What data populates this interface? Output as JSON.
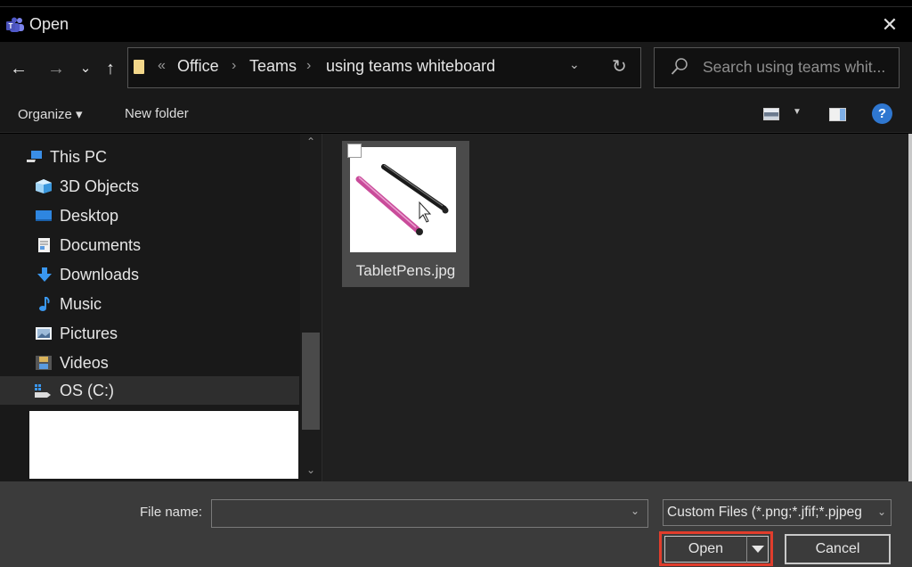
{
  "window": {
    "title": "Open",
    "app_icon": "teams-icon",
    "close_glyph": "✕"
  },
  "nav": {
    "back_glyph": "←",
    "forward_glyph": "→",
    "recent_glyph": "⌄",
    "up_glyph": "↑",
    "breadcrumb": {
      "overflow": "«",
      "items": [
        "Office",
        "Teams",
        "using teams whiteboard"
      ],
      "separator": "›"
    },
    "address_dropdown_glyph": "⌄",
    "refresh_glyph": "↻",
    "search_placeholder": "Search using teams whit..."
  },
  "toolbar": {
    "organize_label": "Organize ▾",
    "new_folder_label": "New folder",
    "view_dropdown_glyph": "▼",
    "help_glyph": "?"
  },
  "sidebar": {
    "items": [
      {
        "label": "This PC",
        "icon": "pc-icon",
        "level": 0,
        "selected": false
      },
      {
        "label": "3D Objects",
        "icon": "3d-objects-icon",
        "level": 1,
        "selected": false
      },
      {
        "label": "Desktop",
        "icon": "desktop-icon",
        "level": 1,
        "selected": false
      },
      {
        "label": "Documents",
        "icon": "documents-icon",
        "level": 1,
        "selected": false
      },
      {
        "label": "Downloads",
        "icon": "downloads-icon",
        "level": 1,
        "selected": false
      },
      {
        "label": "Music",
        "icon": "music-icon",
        "level": 1,
        "selected": false
      },
      {
        "label": "Pictures",
        "icon": "pictures-icon",
        "level": 1,
        "selected": false
      },
      {
        "label": "Videos",
        "icon": "videos-icon",
        "level": 1,
        "selected": false
      },
      {
        "label": "OS (C:)",
        "icon": "drive-icon",
        "level": 1,
        "selected": true
      }
    ],
    "scroll_up_glyph": "⌃",
    "scroll_down_glyph": "⌄"
  },
  "files": [
    {
      "name": "TabletPens.jpg",
      "selected": true
    }
  ],
  "footer": {
    "file_name_label": "File name:",
    "file_name_value": "",
    "file_name_dropdown_glyph": "⌄",
    "file_type_value": "Custom Files (*.png;*.jfif;*.pjpeg",
    "file_type_dropdown_glyph": "⌄",
    "open_label": "Open",
    "cancel_label": "Cancel"
  },
  "colors": {
    "highlight_border": "#e13d2c",
    "help_blue": "#2f77d0",
    "folder_yellow": "#f3d78a"
  }
}
